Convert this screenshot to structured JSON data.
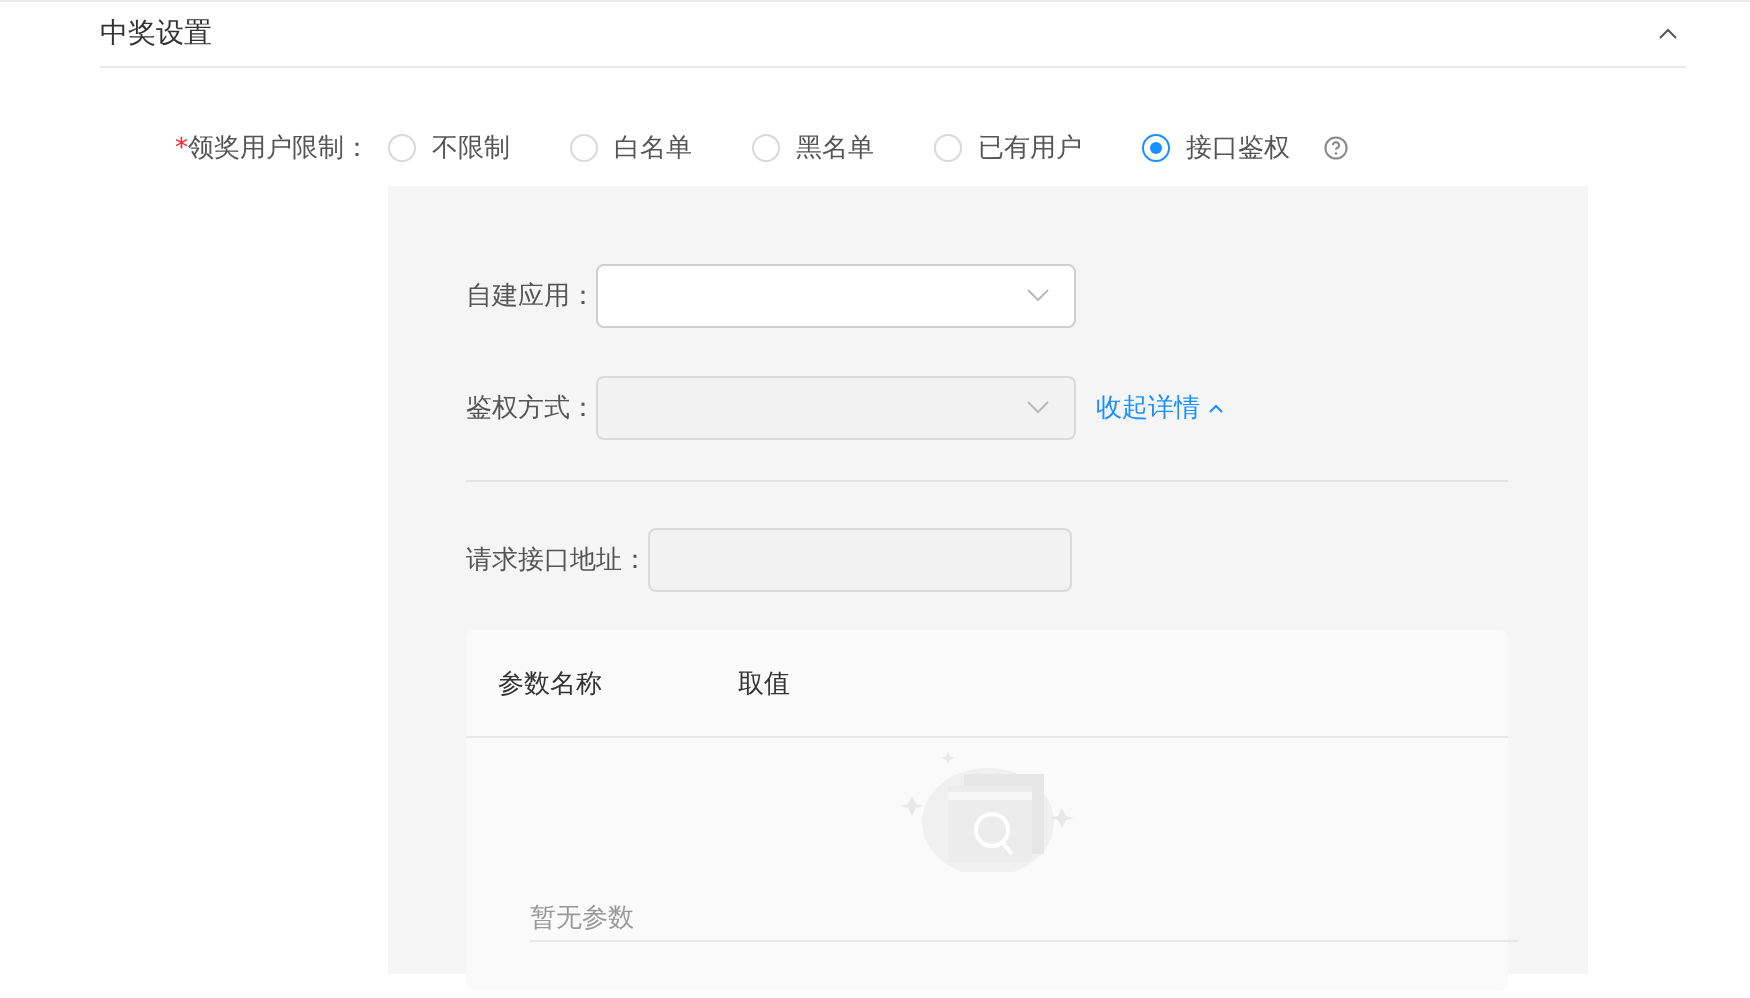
{
  "section": {
    "title": "中奖设置",
    "expanded": true
  },
  "user_limit": {
    "label": "领奖用户限制：",
    "required_mark": "*",
    "options": [
      {
        "label": "不限制",
        "selected": false
      },
      {
        "label": "白名单",
        "selected": false
      },
      {
        "label": "黑名单",
        "selected": false
      },
      {
        "label": "已有用户",
        "selected": false
      },
      {
        "label": "接口鉴权",
        "selected": true,
        "help": true
      }
    ]
  },
  "app_field": {
    "label": "自建应用：",
    "disabled": false
  },
  "auth_field": {
    "label": "鉴权方式：",
    "disabled": true
  },
  "collapse_link": {
    "label": "收起详情"
  },
  "url_field": {
    "label": "请求接口地址：",
    "disabled": true
  },
  "params_table": {
    "columns": [
      "参数名称",
      "取值"
    ],
    "empty_text": "暂无参数"
  }
}
